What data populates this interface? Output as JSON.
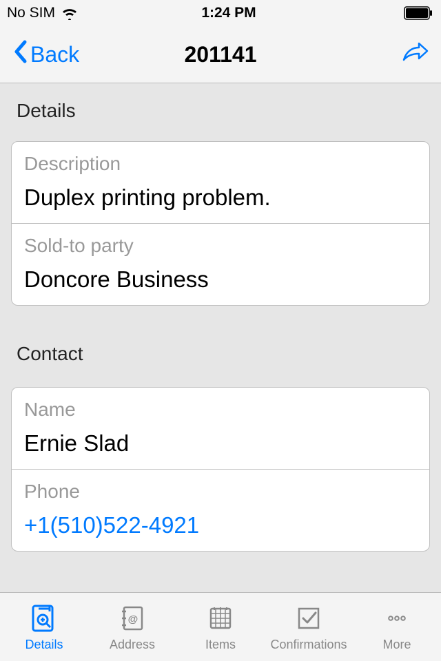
{
  "status": {
    "carrier": "No SIM",
    "time": "1:24 PM"
  },
  "nav": {
    "back_label": "Back",
    "title": "201141"
  },
  "sections": {
    "details_header": "Details",
    "contact_header": "Contact"
  },
  "details": {
    "description_label": "Description",
    "description_value": "Duplex printing problem.",
    "soldto_label": "Sold-to party",
    "soldto_value": "Doncore Business"
  },
  "contact": {
    "name_label": "Name",
    "name_value": "Ernie Slad",
    "phone_label": "Phone",
    "phone_value": "+1(510)522-4921"
  },
  "tabs": {
    "details": "Details",
    "address": "Address",
    "items": "Items",
    "confirmations": "Confirmations",
    "more": "More"
  }
}
